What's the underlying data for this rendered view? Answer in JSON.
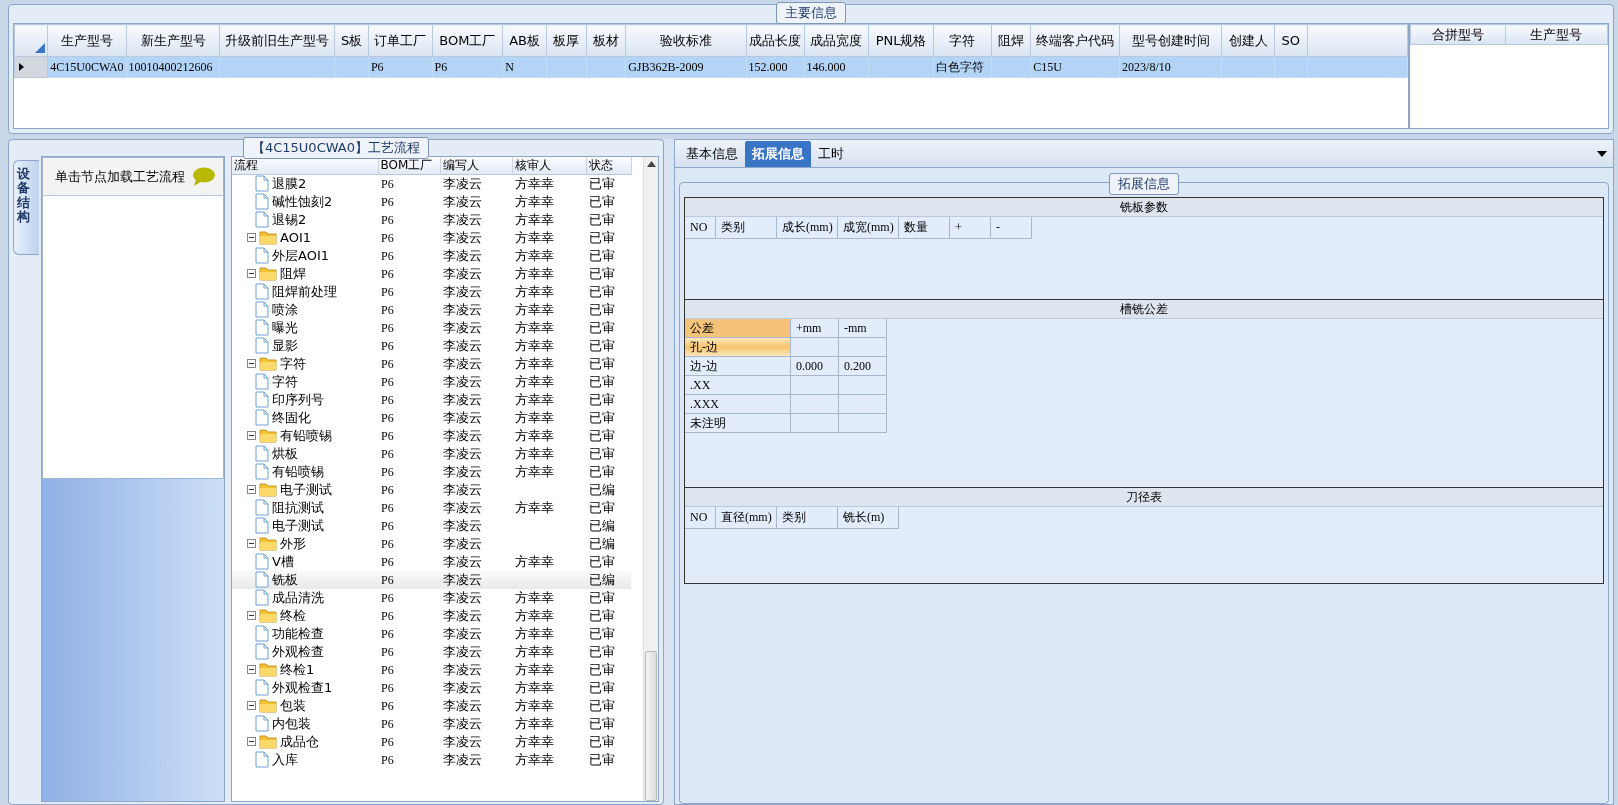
{
  "main_info": {
    "title": "主要信息",
    "columns": [
      "生产型号",
      "新生产型号",
      "升级前旧生产型号",
      "S板",
      "订单工厂",
      "BOM工厂",
      "AB板",
      "板厚",
      "板材",
      "验收标准",
      "成品长度",
      "成品宽度",
      "PNL规格",
      "字符",
      "阻焊",
      "终端客户代码",
      "型号创建时间",
      "创建人",
      "SO"
    ],
    "rows": [
      {
        "selected": true,
        "cells": [
          "4C15U0CWA0",
          "10010400212606",
          null,
          null,
          "P6",
          "P6",
          "N",
          null,
          null,
          "GJB362B-2009",
          "152.000",
          "146.000",
          null,
          "白色字符",
          null,
          "C15U",
          "2023/8/10",
          null,
          null
        ]
      }
    ]
  },
  "merge_grid": {
    "columns": [
      "合拼型号",
      "生产型号"
    ]
  },
  "process": {
    "title": "【4C15U0CWA0】工艺流程",
    "side_tabs": [
      {
        "label": "设备结构",
        "selected": true
      }
    ],
    "hint": "单击节点加载工艺流程",
    "columns": [
      "流程",
      "BOM工厂",
      "编写人",
      "核审人",
      "状态"
    ],
    "rows": [
      {
        "kind": "continuation",
        "children": [
          {
            "name": "退膜2",
            "bom": "P6",
            "author": "李凌云",
            "reviewer": "方幸幸",
            "status": "已审",
            "selected": false
          },
          {
            "name": "碱性蚀刻2",
            "bom": "P6",
            "author": "李凌云",
            "reviewer": "方幸幸",
            "status": "已审",
            "selected": false
          },
          {
            "name": "退锡2",
            "bom": "P6",
            "author": "李凌云",
            "reviewer": "方幸幸",
            "status": "已审",
            "selected": false
          }
        ]
      },
      {
        "name": "AOI1",
        "bom": "P6",
        "author": "李凌云",
        "reviewer": "方幸幸",
        "status": "已审",
        "selected": false,
        "expanded": true,
        "children": [
          {
            "name": "外层AOI1",
            "bom": "P6",
            "author": "李凌云",
            "reviewer": "方幸幸",
            "status": "已审",
            "selected": false
          }
        ]
      },
      {
        "name": "阻焊",
        "bom": "P6",
        "author": "李凌云",
        "reviewer": "方幸幸",
        "status": "已审",
        "selected": false,
        "expanded": true,
        "children": [
          {
            "name": "阻焊前处理",
            "bom": "P6",
            "author": "李凌云",
            "reviewer": "方幸幸",
            "status": "已审",
            "selected": false
          },
          {
            "name": "喷涂",
            "bom": "P6",
            "author": "李凌云",
            "reviewer": "方幸幸",
            "status": "已审",
            "selected": false
          },
          {
            "name": "曝光",
            "bom": "P6",
            "author": "李凌云",
            "reviewer": "方幸幸",
            "status": "已审",
            "selected": false
          },
          {
            "name": "显影",
            "bom": "P6",
            "author": "李凌云",
            "reviewer": "方幸幸",
            "status": "已审",
            "selected": false
          }
        ]
      },
      {
        "name": "字符",
        "bom": "P6",
        "author": "李凌云",
        "reviewer": "方幸幸",
        "status": "已审",
        "selected": false,
        "expanded": true,
        "children": [
          {
            "name": "字符",
            "bom": "P6",
            "author": "李凌云",
            "reviewer": "方幸幸",
            "status": "已审",
            "selected": false
          },
          {
            "name": "印序列号",
            "bom": "P6",
            "author": "李凌云",
            "reviewer": "方幸幸",
            "status": "已审",
            "selected": false
          },
          {
            "name": "终固化",
            "bom": "P6",
            "author": "李凌云",
            "reviewer": "方幸幸",
            "status": "已审",
            "selected": false
          }
        ]
      },
      {
        "name": "有铅喷锡",
        "bom": "P6",
        "author": "李凌云",
        "reviewer": "方幸幸",
        "status": "已审",
        "selected": false,
        "expanded": true,
        "children": [
          {
            "name": "烘板",
            "bom": "P6",
            "author": "李凌云",
            "reviewer": "方幸幸",
            "status": "已审",
            "selected": false
          },
          {
            "name": "有铅喷锡",
            "bom": "P6",
            "author": "李凌云",
            "reviewer": "方幸幸",
            "status": "已审",
            "selected": false
          }
        ]
      },
      {
        "name": "电子测试",
        "bom": "P6",
        "author": "李凌云",
        "status": "已编",
        "selected": false,
        "expanded": true,
        "children": [
          {
            "name": "阻抗测试",
            "bom": "P6",
            "author": "李凌云",
            "reviewer": "方幸幸",
            "status": "已审",
            "selected": false
          },
          {
            "name": "电子测试",
            "bom": "P6",
            "author": "李凌云",
            "status": "已编",
            "selected": false
          }
        ]
      },
      {
        "name": "外形",
        "bom": "P6",
        "author": "李凌云",
        "status": "已编",
        "selected": false,
        "expanded": true,
        "children": [
          {
            "name": "V槽",
            "bom": "P6",
            "author": "李凌云",
            "reviewer": "方幸幸",
            "status": "已审",
            "selected": false
          },
          {
            "name": "铣板",
            "bom": "P6",
            "author": "李凌云",
            "status": "已编",
            "selected": true
          },
          {
            "name": "成品清洗",
            "bom": "P6",
            "author": "李凌云",
            "reviewer": "方幸幸",
            "status": "已审",
            "selected": false
          }
        ]
      },
      {
        "name": "终检",
        "bom": "P6",
        "author": "李凌云",
        "reviewer": "方幸幸",
        "status": "已审",
        "selected": false,
        "expanded": true,
        "children": [
          {
            "name": "功能检查",
            "bom": "P6",
            "author": "李凌云",
            "reviewer": "方幸幸",
            "status": "已审",
            "selected": false
          },
          {
            "name": "外观检查",
            "bom": "P6",
            "author": "李凌云",
            "reviewer": "方幸幸",
            "status": "已审",
            "selected": false
          }
        ]
      },
      {
        "name": "终检1",
        "bom": "P6",
        "author": "李凌云",
        "reviewer": "方幸幸",
        "status": "已审",
        "selected": false,
        "expanded": true,
        "children": [
          {
            "name": "外观检查1",
            "bom": "P6",
            "author": "李凌云",
            "reviewer": "方幸幸",
            "status": "已审",
            "selected": false
          }
        ]
      },
      {
        "name": "包装",
        "bom": "P6",
        "author": "李凌云",
        "reviewer": "方幸幸",
        "status": "已审",
        "selected": false,
        "expanded": true,
        "children": [
          {
            "name": "内包装",
            "bom": "P6",
            "author": "李凌云",
            "reviewer": "方幸幸",
            "status": "已审",
            "selected": false
          }
        ]
      },
      {
        "name": "成品仓",
        "bom": "P6",
        "author": "李凌云",
        "reviewer": "方幸幸",
        "status": "已审",
        "selected": false,
        "expanded": true,
        "children": [
          {
            "name": "入库",
            "bom": "P6",
            "author": "李凌云",
            "reviewer": "方幸幸",
            "status": "已审",
            "selected": false
          }
        ]
      }
    ]
  },
  "detail": {
    "tabs": [
      {
        "label": "基本信息",
        "selected": false
      },
      {
        "label": "拓展信息",
        "selected": true
      },
      {
        "label": "工时",
        "selected": false
      }
    ],
    "title": "拓展信息",
    "sections": [
      {
        "kind": "grid",
        "title": "铣板参数",
        "columns": [
          "NO",
          "类别",
          "成长(mm)",
          "成宽(mm)",
          "数量",
          "+",
          "-"
        ]
      },
      {
        "kind": "tolerance",
        "title": "槽铣公差",
        "columns": [
          "公差",
          "+mm",
          "-mm"
        ],
        "rows": [
          {
            "label": "孔-边",
            "selected": true
          },
          {
            "label": "边-边",
            "selected": false,
            "plus": "0.000",
            "minus": "0.200"
          },
          {
            "label": ".XX",
            "selected": false
          },
          {
            "label": ".XXX",
            "selected": false
          },
          {
            "label": "未注明",
            "selected": false
          }
        ]
      },
      {
        "kind": "grid",
        "title": "刀径表",
        "columns": [
          "NO",
          "直径(mm)",
          "类别",
          "铣长(m)"
        ]
      }
    ]
  }
}
